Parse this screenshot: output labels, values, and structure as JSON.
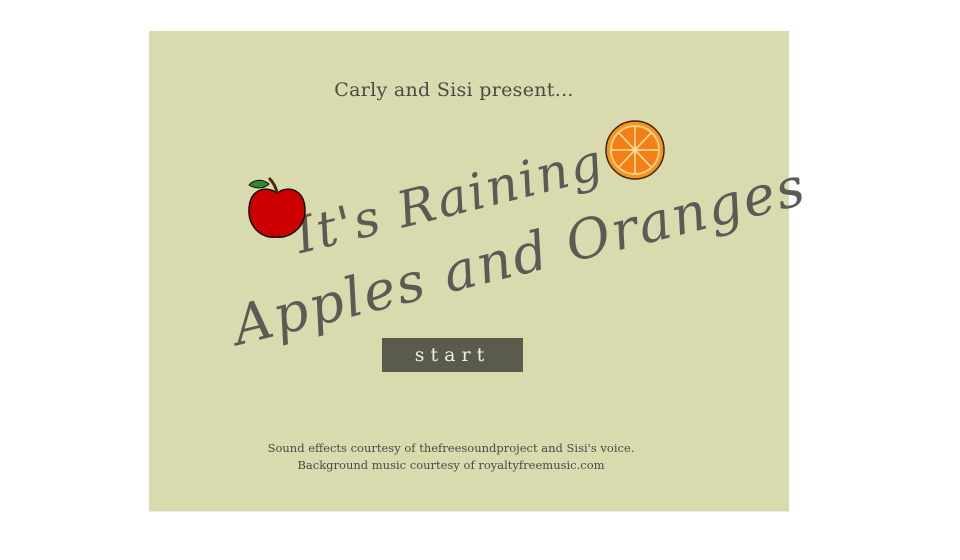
{
  "game": {
    "presenter": "Carly and Sisi present...",
    "title_line1": "It's Raining",
    "title_line2": "Apples and Oranges",
    "start_label": "start",
    "credits_line1": "Sound effects courtesy of thefreesoundproject and Sisi's voice.",
    "credits_line2": "Background music courtesy of royaltyfreemusic.com"
  },
  "icons": {
    "apple": "apple-icon",
    "orange": "orange-slice-icon"
  },
  "colors": {
    "stage_background": "#d9daae",
    "title_text": "#5b5b55",
    "button_background": "#5a5b4b",
    "button_text": "#f1f0e2",
    "apple_red": "#cc0000",
    "orange": "#f7931e"
  }
}
